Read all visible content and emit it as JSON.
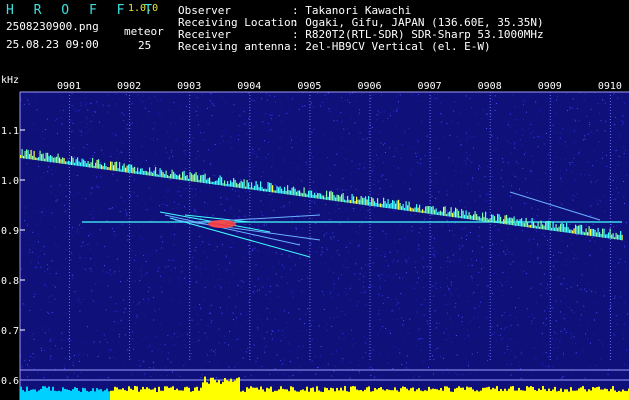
{
  "header": {
    "app_name": "H R O F F T",
    "version": "1.0.0",
    "filename": "2508230900.png",
    "datetime": "25.08.23 09:00",
    "meteor_label": "meteor",
    "meteor_count": "25",
    "labels": {
      "observer": "Observer",
      "location": "Receiving Location",
      "receiver": "Receiver",
      "antenna": "Receiving antenna"
    },
    "values": {
      "observer": ": Takanori Kawachi",
      "location": ": Ogaki, Gifu, JAPAN (136.60E, 35.35N)",
      "receiver": ": R820T2(RTL-SDR) SDR-Sharp 53.1000MHz",
      "antenna": ": 2el-HB9CV Vertical (el. E-W)"
    }
  },
  "plot": {
    "y_unit": "kHz",
    "y_ticks": [
      "1.1",
      "1.0",
      "0.9",
      "0.8",
      "0.7",
      "0.6"
    ],
    "time_ticks": [
      "0901",
      "0902",
      "0903",
      "0904",
      "0905",
      "0906",
      "0907",
      "0908",
      "0909",
      "0910"
    ],
    "colors": {
      "background": "#10107a",
      "grid": "#9a9aff",
      "signal_hot": "#ff4040",
      "signal_warm": "#ffff40",
      "signal_cool": "#40ffff",
      "histogram": "#ffff00",
      "histogram_left": "#00d0ff"
    }
  }
}
